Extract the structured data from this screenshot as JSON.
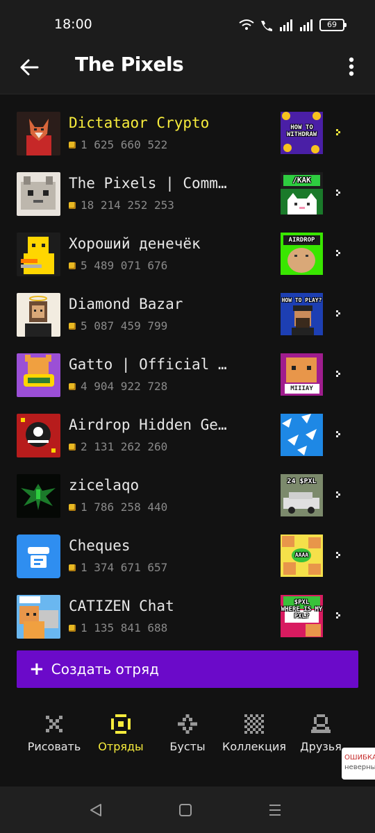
{
  "status_bar": {
    "time": "18:00",
    "battery": "69"
  },
  "header": {
    "title": "The Pixels"
  },
  "squads": [
    {
      "name": "Dictataor Crypto",
      "count": "1 625 660 522",
      "highlight": true,
      "thumb_text": "HOW TO\nWITHDRAW"
    },
    {
      "name": "The Pixels | Community",
      "count": "18 214 252 253",
      "highlight": false,
      "thumb_text": "/KAK"
    },
    {
      "name": "Хороший денечёк",
      "count": "5 489 071 676",
      "highlight": false,
      "thumb_text": "AIRDROP"
    },
    {
      "name": "Diamond Bazar",
      "count": "5 087 459 799",
      "highlight": false,
      "thumb_text": "HOW TO PLAY?"
    },
    {
      "name": "Gatto | Official Channel",
      "count": "4 904 922 728",
      "highlight": false,
      "thumb_text": "MIIIAY"
    },
    {
      "name": "Airdrop Hidden Gems",
      "count": "2 131 262 260",
      "highlight": false,
      "thumb_text": ""
    },
    {
      "name": "zicelaqo",
      "count": "1 786 258 440",
      "highlight": false,
      "thumb_text": "24 $PXL"
    },
    {
      "name": "Cheques",
      "count": "1 374 671 657",
      "highlight": false,
      "thumb_text": "AAAA"
    },
    {
      "name": "CATIZEN Chat",
      "count": "1 135 841 688",
      "highlight": false,
      "thumb_text": "$PXL\nWHERE IS MY PXL?"
    }
  ],
  "create_button": {
    "label": "Создать отряд"
  },
  "bottom_nav": [
    {
      "label": "Рисовать",
      "icon": "draw-icon",
      "active": false
    },
    {
      "label": "Отряды",
      "icon": "squads-icon",
      "active": true
    },
    {
      "label": "Бусты",
      "icon": "boosts-icon",
      "active": false
    },
    {
      "label": "Коллекция",
      "icon": "collection-icon",
      "active": false
    },
    {
      "label": "Друзья",
      "icon": "friends-icon",
      "active": false
    }
  ],
  "error_badge": {
    "title": "ОШИБКА",
    "subtitle": "неверный"
  },
  "colors": {
    "accent_yellow": "#f7ec3c",
    "create_button": "#6b0ac9",
    "background": "#121212"
  }
}
